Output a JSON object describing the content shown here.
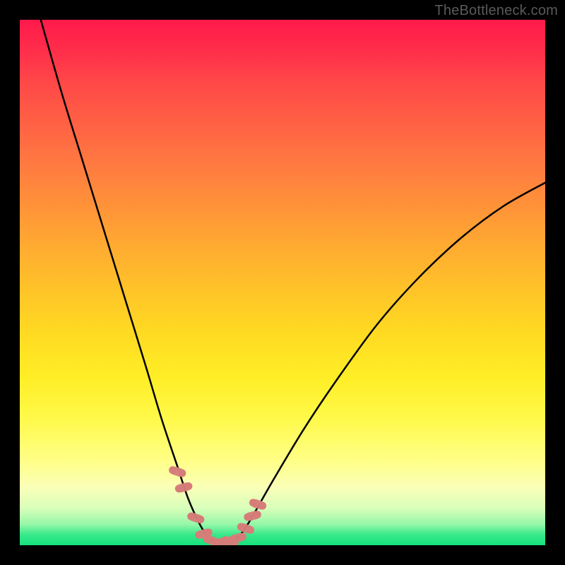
{
  "attribution": "TheBottleneck.com",
  "colors": {
    "frame": "#000000",
    "curve": "#000000",
    "marker": "#d67d79",
    "gradient_top": "#ff1a4b",
    "gradient_bottom": "#16e17e"
  },
  "chart_data": {
    "type": "line",
    "title": "",
    "xlabel": "",
    "ylabel": "",
    "xlim": [
      0,
      100
    ],
    "ylim": [
      0,
      100
    ],
    "series": [
      {
        "name": "bottleneck-curve",
        "x": [
          4,
          8,
          12,
          16,
          20,
          24,
          27,
          30,
          32,
          34,
          35.5,
          37,
          39,
          40.5,
          42,
          44,
          48,
          54,
          60,
          68,
          76,
          84,
          92,
          100
        ],
        "y": [
          100,
          86,
          73,
          60,
          47,
          34,
          24,
          15,
          9,
          4.5,
          2,
          0.8,
          0.5,
          0.8,
          2,
          5,
          12,
          22,
          31,
          42,
          51,
          58.5,
          64.5,
          69
        ]
      }
    ],
    "markers": {
      "name": "highlight-points",
      "x": [
        30,
        31.2,
        33.5,
        35,
        36.5,
        38.5,
        40,
        41.5,
        43,
        44.3,
        45.3
      ],
      "y": [
        14,
        11,
        5.2,
        2.2,
        0.9,
        0.6,
        0.7,
        1.4,
        3.2,
        5.6,
        7.8
      ]
    }
  }
}
